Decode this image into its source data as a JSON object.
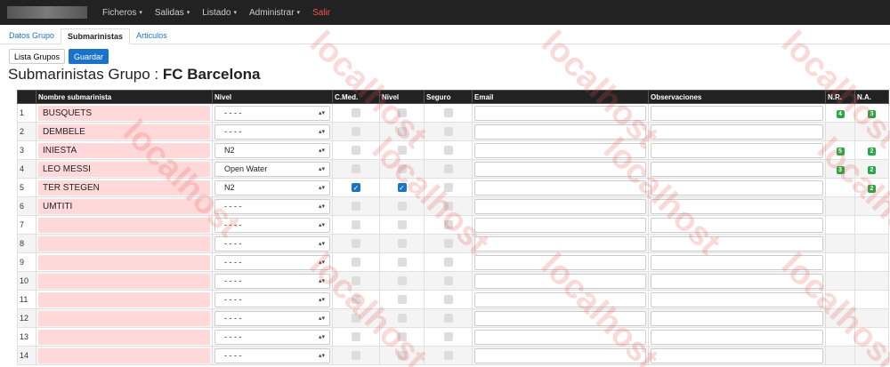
{
  "nav": {
    "items": [
      {
        "label": "Ficheros",
        "caret": "▾"
      },
      {
        "label": "Salidas",
        "caret": "▾"
      },
      {
        "label": "Listado",
        "caret": "▾"
      },
      {
        "label": "Administrar",
        "caret": "▾"
      }
    ],
    "logout": "Salir"
  },
  "tabs": [
    "Datos Grupo",
    "Submarinistas",
    "Articulos"
  ],
  "actions": {
    "list": "Lista Grupos",
    "save": "Guardar"
  },
  "title": {
    "prefix": "Submarinistas Grupo : ",
    "group": "FC Barcelona"
  },
  "table": {
    "headers": [
      "",
      "Nombre submarinista",
      "Nivel",
      "C.Med.",
      "Nivel",
      "Seguro",
      "Email",
      "Observaciones",
      "N.R.",
      "N.A."
    ],
    "rows": [
      {
        "n": "1",
        "name": "BUSQUETS",
        "level": "- - - -",
        "cmed": false,
        "nivel": false,
        "nr": "4",
        "na": "3"
      },
      {
        "n": "2",
        "name": "DEMBELE",
        "level": "- - - -",
        "cmed": false,
        "nivel": false,
        "nr": "",
        "na": ""
      },
      {
        "n": "3",
        "name": "INIESTA",
        "level": "N2",
        "cmed": false,
        "nivel": false,
        "nr": "5",
        "na": "2"
      },
      {
        "n": "4",
        "name": "LEO MESSI",
        "level": "Open Water",
        "cmed": false,
        "nivel": false,
        "nr": "3",
        "na": "2"
      },
      {
        "n": "5",
        "name": "TER STEGEN",
        "level": "N2",
        "cmed": true,
        "nivel": true,
        "nr": "",
        "na": "2"
      },
      {
        "n": "6",
        "name": "UMTITI",
        "level": "- - - -",
        "cmed": false,
        "nivel": false,
        "nr": "",
        "na": ""
      },
      {
        "n": "7",
        "name": "",
        "level": "- - - -",
        "cmed": false,
        "nivel": false,
        "nr": "",
        "na": ""
      },
      {
        "n": "8",
        "name": "",
        "level": "- - - -",
        "cmed": false,
        "nivel": false,
        "nr": "",
        "na": ""
      },
      {
        "n": "9",
        "name": "",
        "level": "- - - -",
        "cmed": false,
        "nivel": false,
        "nr": "",
        "na": ""
      },
      {
        "n": "10",
        "name": "",
        "level": "- - - -",
        "cmed": false,
        "nivel": false,
        "nr": "",
        "na": ""
      },
      {
        "n": "11",
        "name": "",
        "level": "- - - -",
        "cmed": false,
        "nivel": false,
        "nr": "",
        "na": ""
      },
      {
        "n": "12",
        "name": "",
        "level": "- - - -",
        "cmed": false,
        "nivel": false,
        "nr": "",
        "na": ""
      },
      {
        "n": "13",
        "name": "",
        "level": "- - - -",
        "cmed": false,
        "nivel": false,
        "nr": "",
        "na": ""
      },
      {
        "n": "14",
        "name": "",
        "level": "- - - -",
        "cmed": false,
        "nivel": false,
        "nr": "",
        "na": ""
      }
    ]
  },
  "watermark": "localhost"
}
